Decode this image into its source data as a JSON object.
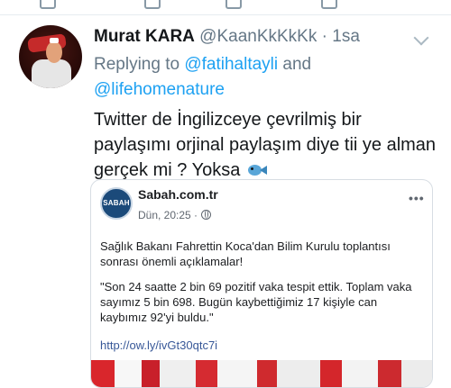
{
  "tweet": {
    "author_name": "Murat KARA",
    "author_handle": "@KaanKkKkKk",
    "separator": " · ",
    "time": "1sa",
    "replying_prefix": "Replying to ",
    "reply_user_1": "@fatihaltayli",
    "reply_and": " and",
    "reply_user_2": "@lifehomenature",
    "text": "Twitter de İngilizceye çevrilmiş bir paylaşımı orjinal paylaşım diye tii ye alman gerçek mi ? Yoksa",
    "emoji": "fish"
  },
  "embed": {
    "logo_text": "SABAH",
    "page_name": "Sabah.com.tr",
    "timestamp": "Dün, 20:25 ·",
    "globe_icon": "globe-icon",
    "paragraph_1": "Sağlık Bakanı Fahrettin Koca'dan Bilim Kurulu toplantısı sonrası önemli açıklamalar!",
    "paragraph_2": "\"Son 24 saatte 2 bin 69 pozitif vaka tespit ettik. Toplam vaka sayımız 5 bin 698. Bugün kaybettiğimiz 17 kişiyle can kaybımız 92'yi buldu.\"",
    "link": "http://ow.ly/ivGt30qtc7i"
  },
  "colors": {
    "link_blue": "#1da1f2",
    "muted_gray": "#657786",
    "fb_link": "#385898",
    "sabah_blue": "#1b4a7a"
  }
}
